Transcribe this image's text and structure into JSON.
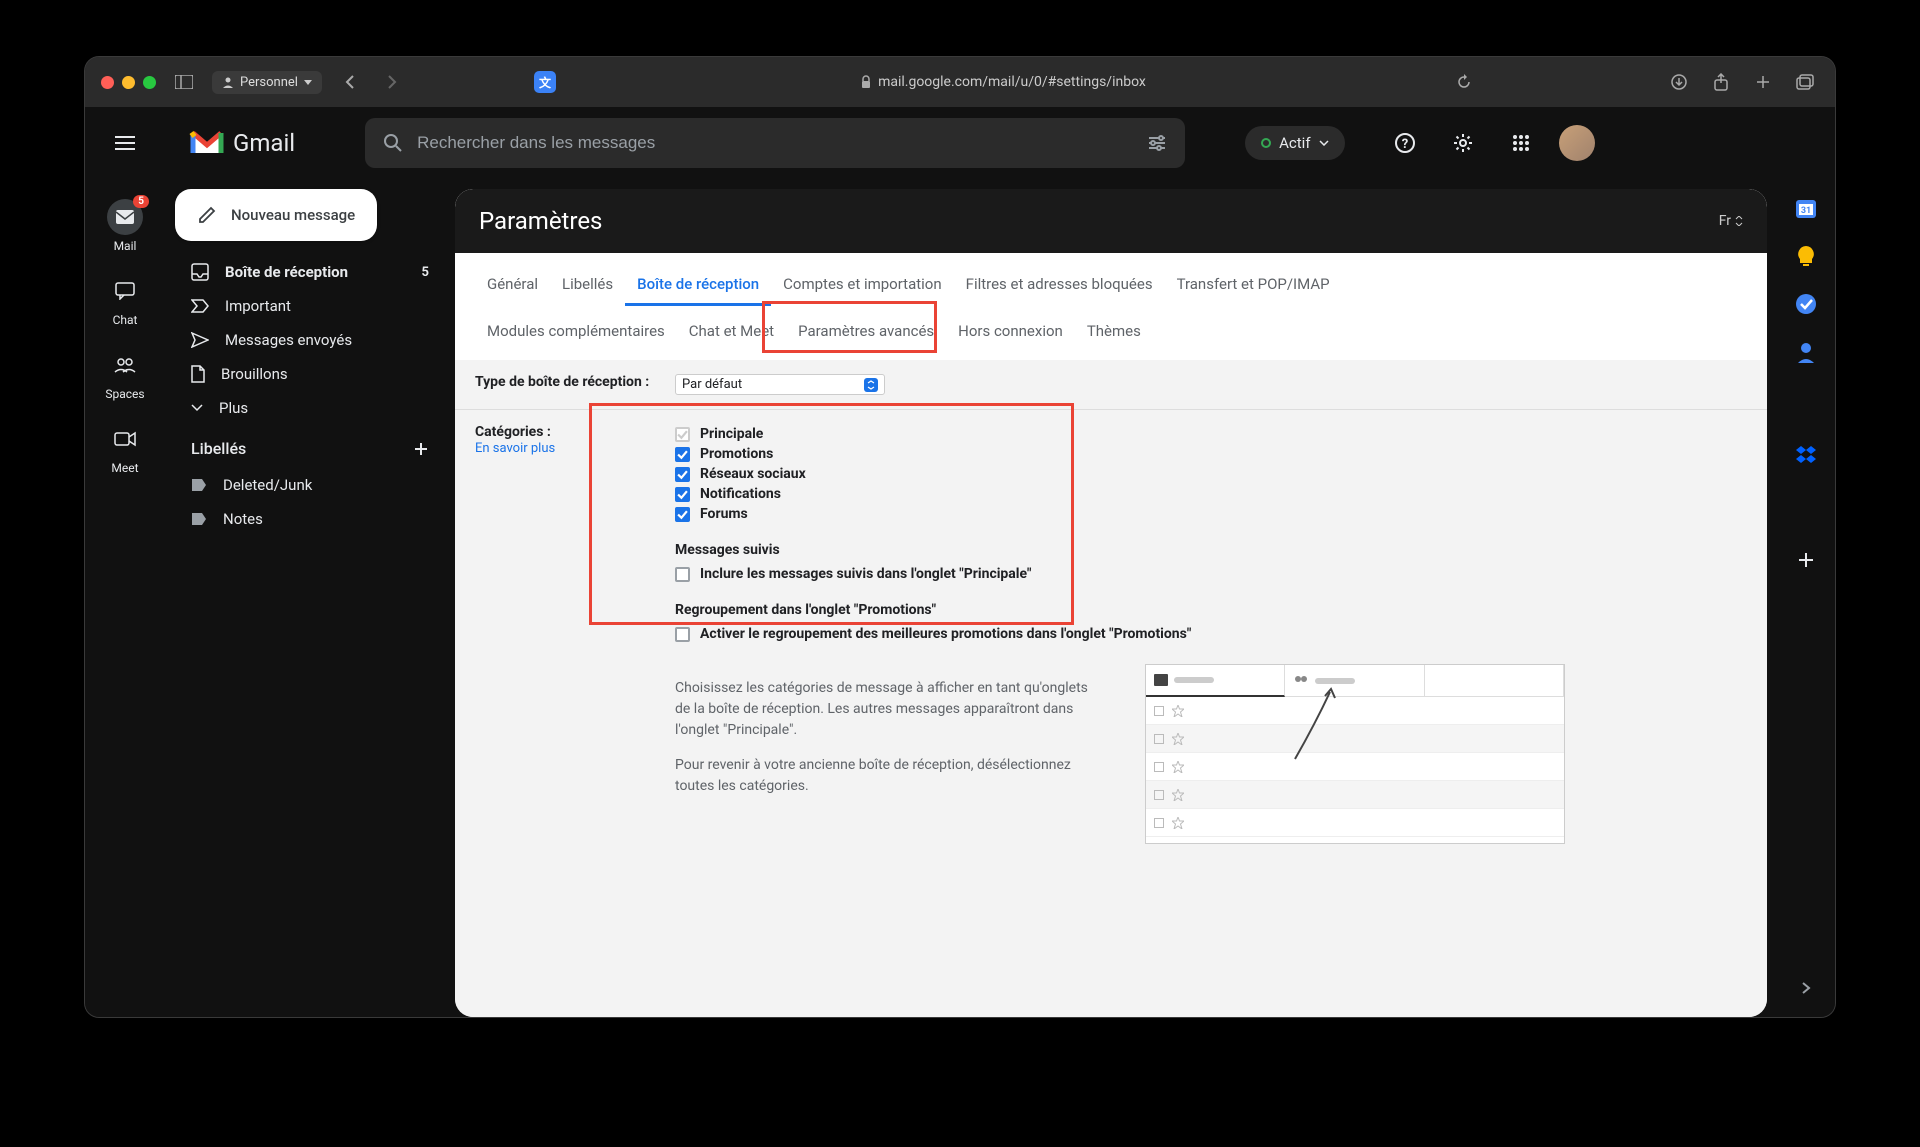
{
  "browser": {
    "profile": "Personnel",
    "url_lock": true,
    "url": "mail.google.com/mail/u/0/#settings/inbox"
  },
  "header": {
    "app_name": "Gmail",
    "search_placeholder": "Rechercher dans les messages",
    "status_label": "Actif"
  },
  "rail": {
    "items": [
      {
        "label": "Mail",
        "badge": "5"
      },
      {
        "label": "Chat"
      },
      {
        "label": "Spaces"
      },
      {
        "label": "Meet"
      }
    ]
  },
  "sidebar": {
    "compose": "Nouveau message",
    "items": [
      {
        "label": "Boîte de réception",
        "count": "5",
        "active": true,
        "icon": "inbox"
      },
      {
        "label": "Important",
        "icon": "important"
      },
      {
        "label": "Messages envoyés",
        "icon": "sent"
      },
      {
        "label": "Brouillons",
        "icon": "draft"
      },
      {
        "label": "Plus",
        "icon": "more"
      }
    ],
    "labels_header": "Libellés",
    "labels": [
      {
        "label": "Deleted/Junk"
      },
      {
        "label": "Notes"
      }
    ]
  },
  "settings": {
    "title": "Paramètres",
    "lang": "Fr",
    "tabs_row1": [
      "Général",
      "Libellés",
      "Boîte de réception",
      "Comptes et importation",
      "Filtres et adresses bloquées",
      "Transfert et POP/IMAP"
    ],
    "tabs_row2": [
      "Modules complémentaires",
      "Chat et Meet",
      "Paramètres avancés",
      "Hors connexion",
      "Thèmes"
    ],
    "active_tab": "Boîte de réception",
    "inbox_type_label": "Type de boîte de réception :",
    "inbox_type_value": "Par défaut",
    "categories_label": "Catégories :",
    "learn_more": "En savoir plus",
    "categories": [
      {
        "label": "Principale",
        "checked": true,
        "disabled": true
      },
      {
        "label": "Promotions",
        "checked": true
      },
      {
        "label": "Réseaux sociaux",
        "checked": true
      },
      {
        "label": "Notifications",
        "checked": true
      },
      {
        "label": "Forums",
        "checked": true
      }
    ],
    "starred_title": "Messages suivis",
    "starred_option": "Inclure les messages suivis dans l'onglet \"Principale\"",
    "bundling_title": "Regroupement dans l'onglet \"Promotions\"",
    "bundling_option": "Activer le regroupement des meilleures promotions dans l'onglet \"Promotions\"",
    "help1": "Choisissez les catégories de message à afficher en tant qu'onglets de la boîte de réception. Les autres messages apparaîtront dans l'onglet \"Principale\".",
    "help2": "Pour revenir à votre ancienne boîte de réception, désélectionnez toutes les catégories."
  }
}
